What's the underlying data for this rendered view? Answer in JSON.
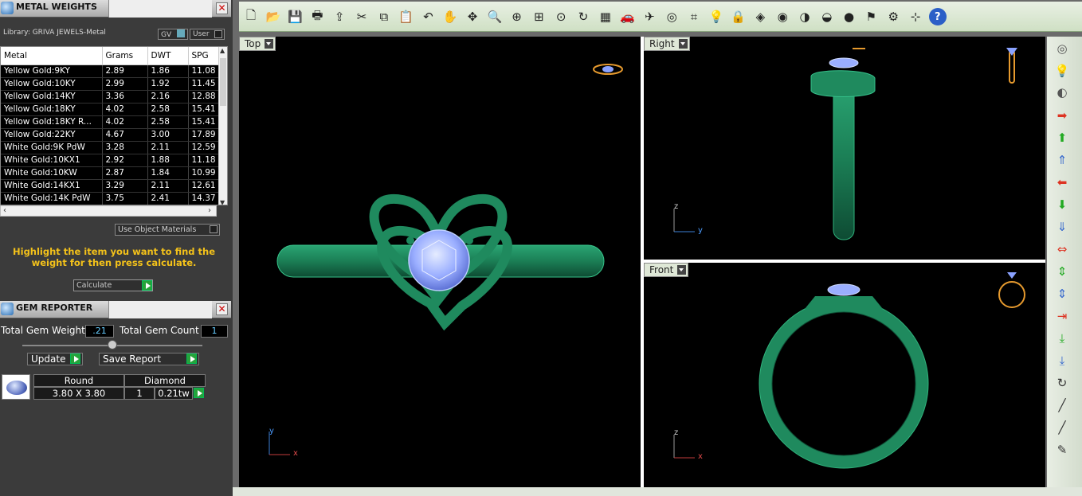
{
  "metal_panel": {
    "title": "METAL WEIGHTS",
    "library": "Library: GRIVA JEWELS-Metal",
    "gv_label": "GV",
    "user_label": "User",
    "columns": [
      "Metal",
      "Grams",
      "DWT",
      "SPG"
    ],
    "rows": [
      [
        "Yellow Gold:9KY",
        "2.89",
        "1.86",
        "11.08"
      ],
      [
        "Yellow Gold:10KY",
        "2.99",
        "1.92",
        "11.45"
      ],
      [
        "Yellow Gold:14KY",
        "3.36",
        "2.16",
        "12.88"
      ],
      [
        "Yellow Gold:18KY",
        "4.02",
        "2.58",
        "15.41"
      ],
      [
        "Yellow Gold:18KY R...",
        "4.02",
        "2.58",
        "15.41"
      ],
      [
        "Yellow Gold:22KY",
        "4.67",
        "3.00",
        "17.89"
      ],
      [
        "White Gold:9K PdW",
        "3.28",
        "2.11",
        "12.59"
      ],
      [
        "White Gold:10KX1",
        "2.92",
        "1.88",
        "11.18"
      ],
      [
        "White Gold:10KW",
        "2.87",
        "1.84",
        "10.99"
      ],
      [
        "White Gold:14KX1",
        "3.29",
        "2.11",
        "12.61"
      ],
      [
        "White Gold:14K PdW",
        "3.75",
        "2.41",
        "14.37"
      ]
    ],
    "use_object_materials": "Use Object Materials",
    "hint": "Highlight the item you want to find the weight for then press calculate.",
    "calculate_label": "Calculate"
  },
  "gem_panel": {
    "title": "GEM REPORTER",
    "total_weight_label": "Total Gem Weight",
    "total_weight_value": ".21",
    "total_count_label": "Total Gem Count",
    "total_count_value": "1",
    "update_label": "Update",
    "save_report_label": "Save Report",
    "gem": {
      "shape": "Round",
      "material": "Diamond",
      "size": "3.80 X 3.80",
      "count": "1",
      "weight": "0.21tw"
    }
  },
  "toolbar": {
    "icons": [
      "new-icon",
      "open-icon",
      "save-icon",
      "print-icon",
      "export-icon",
      "cut-icon",
      "copy-icon",
      "paste-icon",
      "undo-icon",
      "pan-hand-icon",
      "rotate-icon",
      "zoom-icon",
      "zoom-window-icon",
      "zoom-extents-icon",
      "zoom-selected-icon",
      "zoom-dynamic-icon",
      "four-views-icon",
      "car-icon",
      "plane-icon",
      "target-icon",
      "transform-icon",
      "bulb-icon",
      "lock-icon",
      "material-icon",
      "color-wheel-icon",
      "shade-sphere-icon",
      "ghost-sphere-icon",
      "render-sphere-icon",
      "select-icon",
      "settings-icon",
      "grid-snap-icon",
      "help-icon"
    ]
  },
  "viewports": {
    "top": {
      "label": "Top",
      "axis_a": "y",
      "axis_b": "x"
    },
    "right": {
      "label": "Right",
      "axis_a": "z",
      "axis_b": "y"
    },
    "front": {
      "label": "Front",
      "axis_a": "z",
      "axis_b": "x"
    }
  },
  "colors": {
    "ring_green": "#1f8a5e",
    "gem_blue": "#8fa6ff",
    "hint_yellow": "#f4c21a",
    "toolbar_bg": "#dde9d5"
  }
}
